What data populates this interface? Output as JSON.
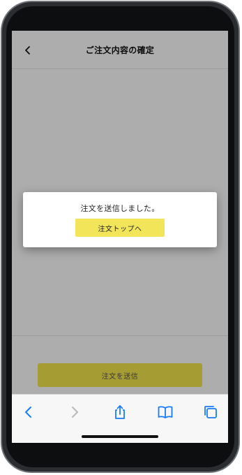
{
  "header": {
    "title": "ご注文内容の確定",
    "back_icon": "chevron-left-icon"
  },
  "footer": {
    "submit_label": "注文を送信"
  },
  "dialog": {
    "message": "注文を送信しました。",
    "button_label": "注文トップへ"
  },
  "browser_toolbar": {
    "icons": [
      "back-arrow-icon",
      "forward-arrow-icon",
      "share-icon",
      "bookmarks-icon",
      "tabs-icon"
    ]
  },
  "colors": {
    "accent_yellow": "#f2e55a",
    "ios_blue": "#1a7cf5"
  }
}
